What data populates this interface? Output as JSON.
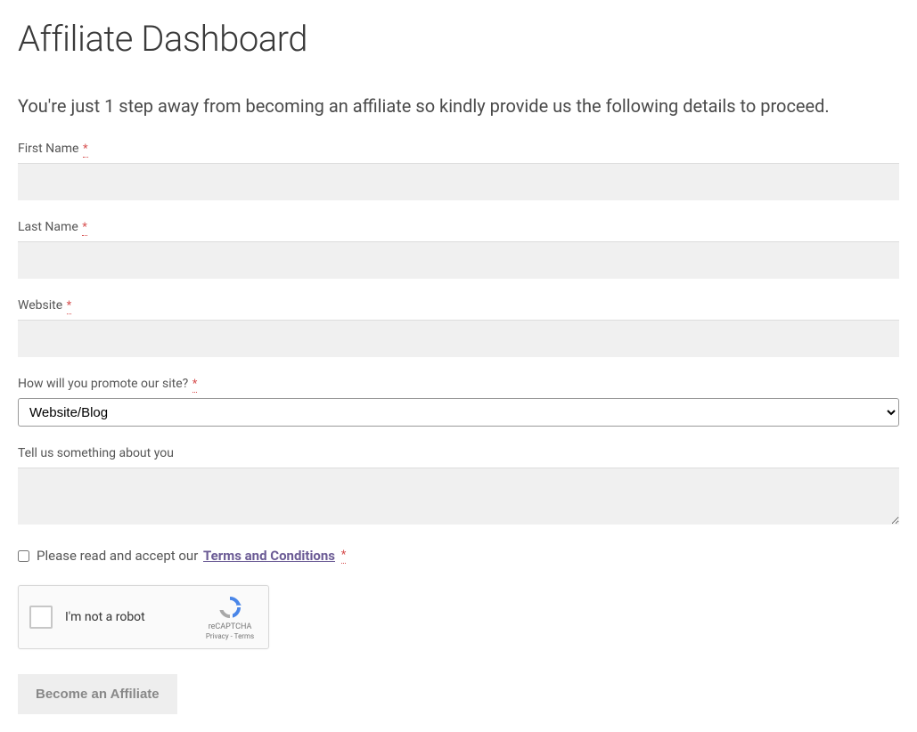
{
  "page": {
    "title": "Affiliate Dashboard",
    "intro": "You're just 1 step away from becoming an affiliate so kindly provide us the following details to proceed."
  },
  "form": {
    "required_mark": "*",
    "first_name": {
      "label": "First Name",
      "value": ""
    },
    "last_name": {
      "label": "Last Name",
      "value": ""
    },
    "website": {
      "label": "Website",
      "value": ""
    },
    "promote": {
      "label": "How will you promote our site?",
      "selected": "Website/Blog"
    },
    "about": {
      "label": "Tell us something about you",
      "value": ""
    },
    "terms": {
      "prefix": "Please read and accept our",
      "link_text": "Terms and Conditions"
    },
    "submit_label": "Become an Affiliate"
  },
  "recaptcha": {
    "label": "I'm not a robot",
    "brand": "reCAPTCHA",
    "links": "Privacy - Terms"
  }
}
